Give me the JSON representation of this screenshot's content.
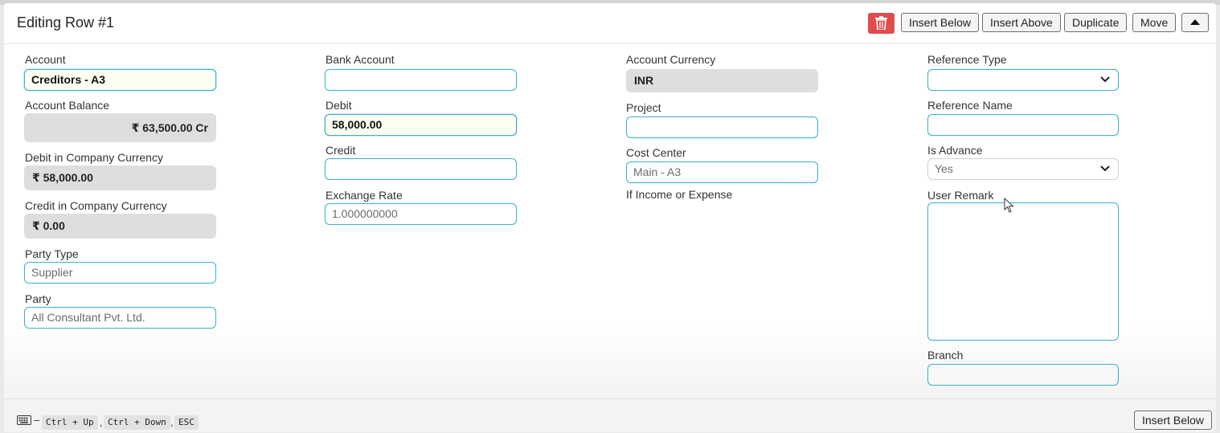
{
  "dialog": {
    "title": "Editing Row #1"
  },
  "toolbar": {
    "insert_below": "Insert Below",
    "insert_above": "Insert Above",
    "duplicate": "Duplicate",
    "move": "Move"
  },
  "col1": {
    "account_label": "Account",
    "account_value": "Creditors - A3",
    "account_balance_label": "Account Balance",
    "account_balance_value": "₹ 63,500.00 Cr",
    "debit_company_label": "Debit in Company Currency",
    "debit_company_value": "₹ 58,000.00",
    "credit_company_label": "Credit in Company Currency",
    "credit_company_value": "₹ 0.00",
    "party_type_label": "Party Type",
    "party_type_value": "Supplier",
    "party_label": "Party",
    "party_value": "All Consultant Pvt. Ltd."
  },
  "col2": {
    "bank_account_label": "Bank Account",
    "bank_account_value": "",
    "debit_label": "Debit",
    "debit_value": "58,000.00",
    "credit_label": "Credit",
    "credit_value": "",
    "exchange_rate_label": "Exchange Rate",
    "exchange_rate_value": "1.000000000"
  },
  "col3": {
    "account_currency_label": "Account Currency",
    "account_currency_value": "INR",
    "project_label": "Project",
    "project_value": "",
    "cost_center_label": "Cost Center",
    "cost_center_value": "Main - A3",
    "cost_center_help": "If Income or Expense"
  },
  "col4": {
    "reference_type_label": "Reference Type",
    "reference_type_value": "",
    "reference_name_label": "Reference Name",
    "reference_name_value": "",
    "is_advance_label": "Is Advance",
    "is_advance_value": "Yes",
    "user_remark_label": "User Remark",
    "user_remark_value": "",
    "branch_label": "Branch",
    "branch_value": ""
  },
  "footer": {
    "dash": "–",
    "shortcut_1": "Ctrl + Up",
    "shortcut_2": "Ctrl + Down",
    "shortcut_3": "ESC",
    "comma": ",",
    "insert_below": "Insert Below"
  },
  "icons": {
    "delete": "trash-icon",
    "move_up": "caret-up-icon",
    "keyboard": "keyboard-icon",
    "dropdown": "chevron-down-icon",
    "cursor": "mouse-pointer-icon"
  },
  "colors": {
    "field_border": "#36b3c9",
    "danger": "#e24c4c",
    "readonly_bg": "#dedede"
  }
}
